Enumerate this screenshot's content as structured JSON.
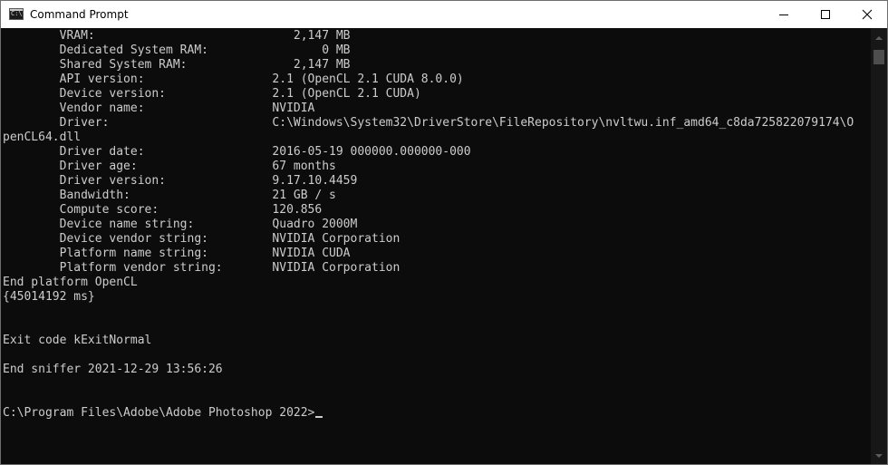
{
  "window": {
    "title": "Command Prompt",
    "icon_text": "C:\\",
    "controls": {
      "minimize": "minimize",
      "maximize": "maximize",
      "close": "close"
    }
  },
  "console": {
    "lines": [
      "        VRAM:                            2,147 MB",
      "        Dedicated System RAM:                0 MB",
      "        Shared System RAM:               2,147 MB",
      "        API version:                  2.1 (OpenCL 2.1 CUDA 8.0.0)",
      "        Device version:               2.1 (OpenCL 2.1 CUDA)",
      "        Vendor name:                  NVIDIA",
      "        Driver:                       C:\\Windows\\System32\\DriverStore\\FileRepository\\nvltwu.inf_amd64_c8da725822079174\\O",
      "penCL64.dll",
      "        Driver date:                  2016-05-19 000000.000000-000",
      "        Driver age:                   67 months",
      "        Driver version:               9.17.10.4459",
      "        Bandwidth:                    21 GB / s",
      "        Compute score:                120.856",
      "        Device name string:           Quadro 2000M",
      "        Device vendor string:         NVIDIA Corporation",
      "        Platform name string:         NVIDIA CUDA",
      "        Platform vendor string:       NVIDIA Corporation",
      "End platform OpenCL",
      "{45014192 ms}",
      "",
      "",
      "Exit code kExitNormal",
      "",
      "End sniffer 2021-12-29 13:56:26",
      "",
      "",
      "C:\\Program Files\\Adobe\\Adobe Photoshop 2022>"
    ]
  },
  "colors": {
    "console_background": "#0c0c0c",
    "console_text": "#cccccc",
    "titlebar_background": "#ffffff",
    "scrollbar_track": "#171717",
    "scrollbar_thumb": "#4d4d4d"
  }
}
